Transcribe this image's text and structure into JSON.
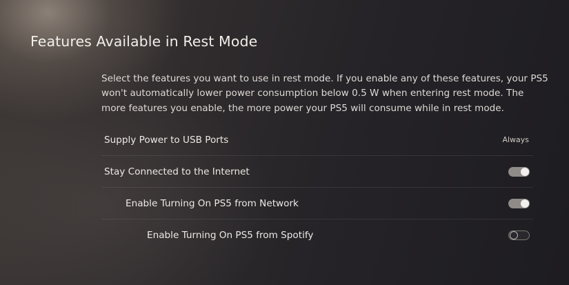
{
  "page": {
    "title": "Features Available in Rest Mode",
    "description": "Select the features you want to use in rest mode. If you enable any of these features, your PS5 won't automatically lower power consumption below 0.5 W when entering rest mode. The more features you enable, the more power your PS5 will consume while in rest mode."
  },
  "settings": [
    {
      "label": "Supply Power to USB Ports",
      "value": "Always"
    },
    {
      "label": "Stay Connected to the Internet",
      "state": "on"
    },
    {
      "label": "Enable Turning On PS5 from Network",
      "state": "on"
    },
    {
      "label": "Enable Turning On PS5 from Spotify",
      "state": "off"
    }
  ],
  "colors": {
    "toggle_on_track": "#8e8b89",
    "toggle_on_knob": "#f2f0ee",
    "toggle_off_border": "#7a7673",
    "text_primary": "#ece9e5"
  }
}
